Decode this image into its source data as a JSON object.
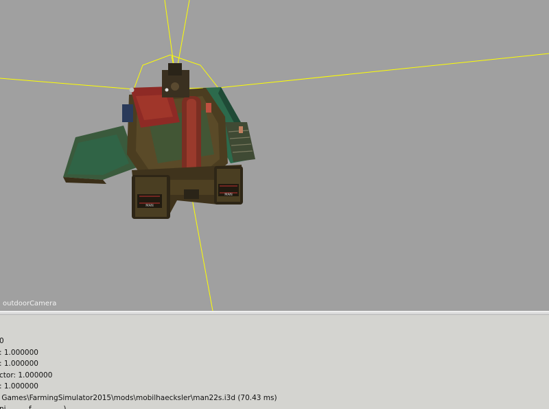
{
  "viewport": {
    "camera_label": "outdoorCamera",
    "background_color": "#a0a0a0",
    "gizmo_color": "#ffff00",
    "model_colors": {
      "body": "#4b3d20",
      "green_panel": "#2e6648",
      "red_cab": "#8e2a25",
      "dark": "#2a2418"
    }
  },
  "console": {
    "lines": [
      "0",
      ": 1.000000",
      ": 1.000000",
      "ctor: 1.000000",
      ": 1.000000",
      " Games\\FarmingSimulator2015\\mods\\mobilhaecksler\\man22s.i3d (70.43 ms)",
      "ni    ...   f              )"
    ]
  }
}
